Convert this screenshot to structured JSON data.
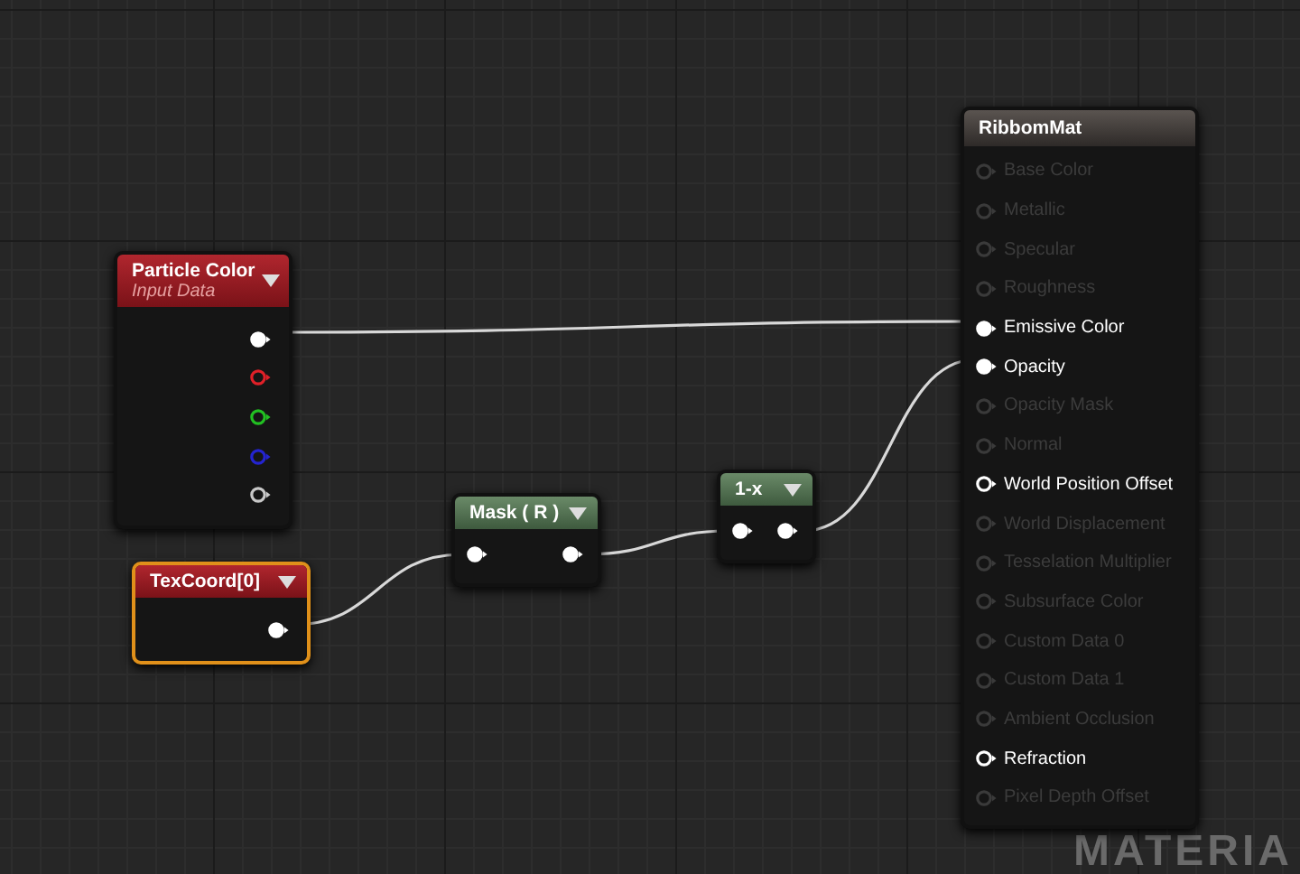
{
  "graph": {
    "nodes": [
      {
        "kind": "parameter",
        "title": "Particle Color",
        "subtitle": "Input Data",
        "selected": false,
        "outputs": [
          {
            "connected": true,
            "color": "#ffffff"
          },
          {
            "connected": false,
            "color": "#e02028"
          },
          {
            "connected": false,
            "color": "#22c022"
          },
          {
            "connected": false,
            "color": "#2424d0"
          },
          {
            "connected": false,
            "color": "#c8c8c8"
          }
        ]
      },
      {
        "kind": "parameter",
        "title": "TexCoord[0]",
        "selected": true,
        "outputs": [
          {
            "connected": true,
            "color": "#ffffff"
          }
        ]
      },
      {
        "kind": "math",
        "title": "Mask ( R )",
        "selected": false,
        "inputs": [
          {
            "connected": true
          }
        ],
        "outputs": [
          {
            "connected": true,
            "color": "#ffffff"
          }
        ]
      },
      {
        "kind": "math",
        "title": "1-x",
        "selected": false,
        "inputs": [
          {
            "connected": true
          }
        ],
        "outputs": [
          {
            "connected": true,
            "color": "#ffffff"
          }
        ]
      },
      {
        "kind": "result",
        "title": "RibbomMat",
        "selected": false,
        "inputs": [
          {
            "label": "Base Color",
            "enabled": false,
            "connected": false
          },
          {
            "label": "Metallic",
            "enabled": false,
            "connected": false
          },
          {
            "label": "Specular",
            "enabled": false,
            "connected": false
          },
          {
            "label": "Roughness",
            "enabled": false,
            "connected": false
          },
          {
            "label": "Emissive Color",
            "enabled": true,
            "connected": true
          },
          {
            "label": "Opacity",
            "enabled": true,
            "connected": true
          },
          {
            "label": "Opacity Mask",
            "enabled": false,
            "connected": false
          },
          {
            "label": "Normal",
            "enabled": false,
            "connected": false
          },
          {
            "label": "World Position Offset",
            "enabled": true,
            "connected": false
          },
          {
            "label": "World Displacement",
            "enabled": false,
            "connected": false
          },
          {
            "label": "Tesselation Multiplier",
            "enabled": false,
            "connected": false
          },
          {
            "label": "Subsurface Color",
            "enabled": false,
            "connected": false
          },
          {
            "label": "Custom Data 0",
            "enabled": false,
            "connected": false
          },
          {
            "label": "Custom Data 1",
            "enabled": false,
            "connected": false
          },
          {
            "label": "Ambient Occlusion",
            "enabled": false,
            "connected": false
          },
          {
            "label": "Refraction",
            "enabled": true,
            "connected": false
          },
          {
            "label": "Pixel Depth Offset",
            "enabled": false,
            "connected": false
          }
        ]
      }
    ],
    "watermark": "MATERIA"
  }
}
